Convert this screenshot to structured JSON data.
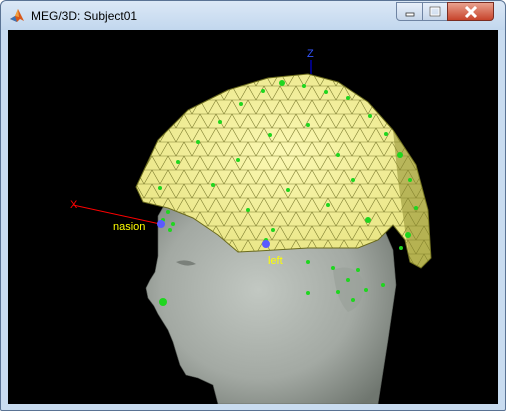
{
  "window": {
    "title": "MEG/3D: Subject01"
  },
  "scene": {
    "axis_labels": {
      "z": "Z",
      "x": "X"
    },
    "fiducial_labels": {
      "nasion": "nasion",
      "left": "left"
    }
  },
  "colors": {
    "canvas_background": "#000000",
    "helmet_fill": "#f2f07e",
    "helmet_wire": "#6b6b1e",
    "head_surface": "#a3a9a3",
    "sensor_marker": "#1fd61f",
    "label_text": "#ffff00",
    "x_axis": "#ff0000",
    "z_axis": "#0000ff"
  },
  "icons": [
    "matlab-icon",
    "minimize-icon",
    "maximize-icon",
    "close-icon"
  ]
}
